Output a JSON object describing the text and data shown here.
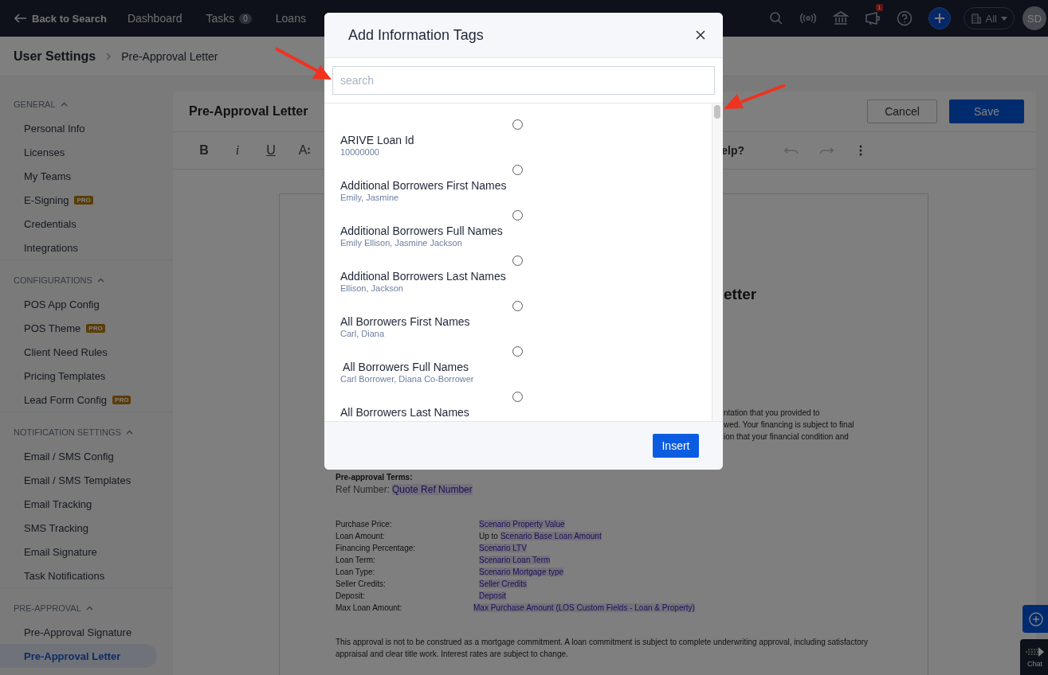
{
  "topbar": {
    "back": "Back to Search",
    "nav": [
      {
        "label": "Dashboard"
      },
      {
        "label": "Tasks",
        "badge": "0"
      },
      {
        "label": "Loans"
      }
    ],
    "notifications_badge": "1",
    "scope": "All",
    "avatar": "SD"
  },
  "header": {
    "breadcrumb": [
      "User Settings",
      "Pre-Approval Letter"
    ]
  },
  "sidebar": {
    "sections": [
      {
        "title": "GENERAL",
        "expanded": true,
        "items": [
          {
            "label": "Personal Info",
            "selected": false
          },
          {
            "label": "Licenses",
            "selected": false
          },
          {
            "label": "My Teams",
            "selected": false
          },
          {
            "label": "E-Signing",
            "badge": "PRO",
            "selected": false
          },
          {
            "label": "Credentials",
            "selected": false
          },
          {
            "label": "Integrations",
            "selected": false
          }
        ]
      },
      {
        "title": "CONFIGURATIONS",
        "expanded": true,
        "items": [
          {
            "label": "POS App Config",
            "selected": false
          },
          {
            "label": "POS Theme",
            "badge": "PRO",
            "selected": false
          },
          {
            "label": "Client Need Rules",
            "selected": false
          },
          {
            "label": "Pricing Templates",
            "selected": false
          },
          {
            "label": "Lead Form Config",
            "badge": "PRO",
            "selected": false
          }
        ]
      },
      {
        "title": "NOTIFICATION SETTINGS",
        "expanded": true,
        "items": [
          {
            "label": "Email / SMS Config",
            "selected": false
          },
          {
            "label": "Email / SMS Templates",
            "selected": false
          },
          {
            "label": "Email Tracking",
            "selected": false
          },
          {
            "label": "SMS Tracking",
            "selected": false
          },
          {
            "label": "Email Signature",
            "selected": false
          },
          {
            "label": "Task Notifications",
            "selected": false
          }
        ]
      },
      {
        "title": "PRE-APPROVAL",
        "expanded": true,
        "items": [
          {
            "label": "Pre-Approval Signature",
            "selected": false
          },
          {
            "label": "Pre-Approval Letter",
            "selected": true
          }
        ]
      }
    ]
  },
  "editor": {
    "title": "Pre-Approval Letter",
    "cancel": "Cancel",
    "save": "Save",
    "toolbar": [
      {
        "kind": "bold",
        "label": "B"
      },
      {
        "kind": "italic",
        "label": "i"
      },
      {
        "kind": "underline",
        "label": "U"
      },
      {
        "kind": "size",
        "label": "A"
      }
    ],
    "help_fragment": "elp?",
    "document": {
      "heading_fragment": "etter",
      "intro_fragments": [
        "ntation that you provided to",
        "wed. Your financing is subject to final",
        "ion that your financial condition and"
      ],
      "terms_title": "Pre-approval Terms:",
      "ref": {
        "label": "Ref Number:",
        "tag": "Quote Ref Number"
      },
      "terms": [
        {
          "label": "Purchase Price:",
          "tag": "Scenario Property Value"
        },
        {
          "label": "Loan Amount:",
          "prefix": "Up to",
          "tag": "Scenario Base Loan Amount"
        },
        {
          "label": "Financing Percentage:",
          "tag": "Scenario LTV"
        },
        {
          "label": "Loan Term:",
          "tag": "Scenario Loan Term"
        },
        {
          "label": "Loan Type:",
          "tag": "Scenario Mortgage type"
        },
        {
          "label": "Seller Credits:",
          "tag": "Seller Credits"
        },
        {
          "label": "Deposit:",
          "tag": "Deposit"
        },
        {
          "label": "Max Loan Amount:",
          "tag": "Max Purchase Amount (LOS Custom Fields - Loan & Property)"
        }
      ],
      "closing": "This approval is not to be construed as a mortgage commitment. A loan commitment is subject to complete underwriting approval, including satisfactory appraisal and clear title work. Interest rates are subject to change."
    }
  },
  "modal": {
    "title": "Add Information Tags",
    "search": {
      "placeholder": "search"
    },
    "tags": [
      {
        "label": "ARIVE Loan Id",
        "sample": "10000000",
        "selected": false
      },
      {
        "label": "Additional Borrowers First Names",
        "sample": "Emily, Jasmine",
        "selected": false
      },
      {
        "label": "Additional Borrowers Full Names",
        "sample": "Emily Ellison, Jasmine Jackson",
        "selected": false
      },
      {
        "label": "Additional Borrowers Last Names",
        "sample": "Ellison, Jackson",
        "selected": false
      },
      {
        "label": "All Borrowers First Names",
        "sample": "Carl, Diana",
        "selected": false
      },
      {
        "label": " All Borrowers Full Names",
        "sample": "Carl Borrower, Diana Co-Borrower",
        "selected": false
      },
      {
        "label": "All Borrowers Last Names",
        "selected": false
      }
    ],
    "insert": "Insert"
  },
  "floating": {
    "chat": "Chat"
  }
}
